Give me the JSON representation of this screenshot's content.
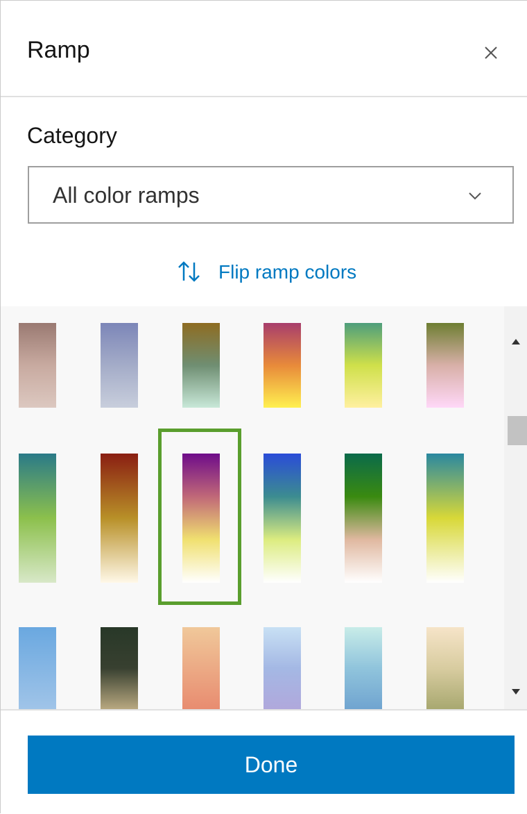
{
  "header": {
    "title": "Ramp",
    "close_icon": "close-icon"
  },
  "category": {
    "label": "Category",
    "selected": "All color ramps",
    "chevron_icon": "chevron-down-icon"
  },
  "flip": {
    "label": "Flip ramp colors",
    "icon": "swap-vertical-icon",
    "color": "#0079c1"
  },
  "ramps": {
    "selected_index": 8,
    "selection_color": "#5a9e2d",
    "rows": [
      [
        {
          "name": "ramp-1",
          "stops": [
            "#9a7a72",
            "#c8aaa0",
            "#dcc8c0"
          ]
        },
        {
          "name": "ramp-2",
          "stops": [
            "#7c86b8",
            "#a4acc8",
            "#c8cedc"
          ]
        },
        {
          "name": "ramp-3",
          "stops": [
            "#8e6c22",
            "#6f8e72",
            "#c8e8d8"
          ]
        },
        {
          "name": "ramp-4",
          "stops": [
            "#a83e6c",
            "#e88a3a",
            "#fff050"
          ]
        },
        {
          "name": "ramp-5",
          "stops": [
            "#4e9e7c",
            "#cfe04a",
            "#fff0a0"
          ]
        },
        {
          "name": "ramp-6",
          "stops": [
            "#6e7e32",
            "#d8b0a8",
            "#ffd8f8"
          ]
        }
      ],
      [
        {
          "name": "ramp-7",
          "stops": [
            "#2a7a88",
            "#8cc04c",
            "#d8e8c8"
          ]
        },
        {
          "name": "ramp-8",
          "stops": [
            "#8a1e12",
            "#b89028",
            "#fff8e8"
          ]
        },
        {
          "name": "ramp-9",
          "stops": [
            "#6e0c8a",
            "#c06878",
            "#f0e070",
            "#ffffff"
          ]
        },
        {
          "name": "ramp-10",
          "stops": [
            "#2a4cd8",
            "#3c8c90",
            "#dcec80",
            "#ffffff"
          ]
        },
        {
          "name": "ramp-11",
          "stops": [
            "#0a6a4a",
            "#3a8a10",
            "#e0b8a0",
            "#ffffff"
          ]
        },
        {
          "name": "ramp-12",
          "stops": [
            "#2a88a0",
            "#d8d838",
            "#ffffff"
          ]
        }
      ],
      [
        {
          "name": "ramp-13",
          "stops": [
            "#6aa8e0",
            "#a0c4e8"
          ]
        },
        {
          "name": "ramp-14",
          "stops": [
            "#283828",
            "#384030",
            "#b8a880"
          ]
        },
        {
          "name": "ramp-15",
          "stops": [
            "#f0c89a",
            "#e88c70"
          ]
        },
        {
          "name": "ramp-16",
          "stops": [
            "#c8e0f4",
            "#a4b8e4",
            "#b0a8dc"
          ]
        },
        {
          "name": "ramp-17",
          "stops": [
            "#c8ece8",
            "#90c4dc",
            "#70a4d0"
          ]
        },
        {
          "name": "ramp-18",
          "stops": [
            "#f6e4c8",
            "#d8cca0",
            "#a8a870"
          ]
        }
      ]
    ]
  },
  "scrollbar": {
    "up_icon": "scroll-up-arrow-icon",
    "down_icon": "scroll-down-arrow-icon"
  },
  "footer": {
    "done_label": "Done",
    "done_color": "#0079c1"
  }
}
